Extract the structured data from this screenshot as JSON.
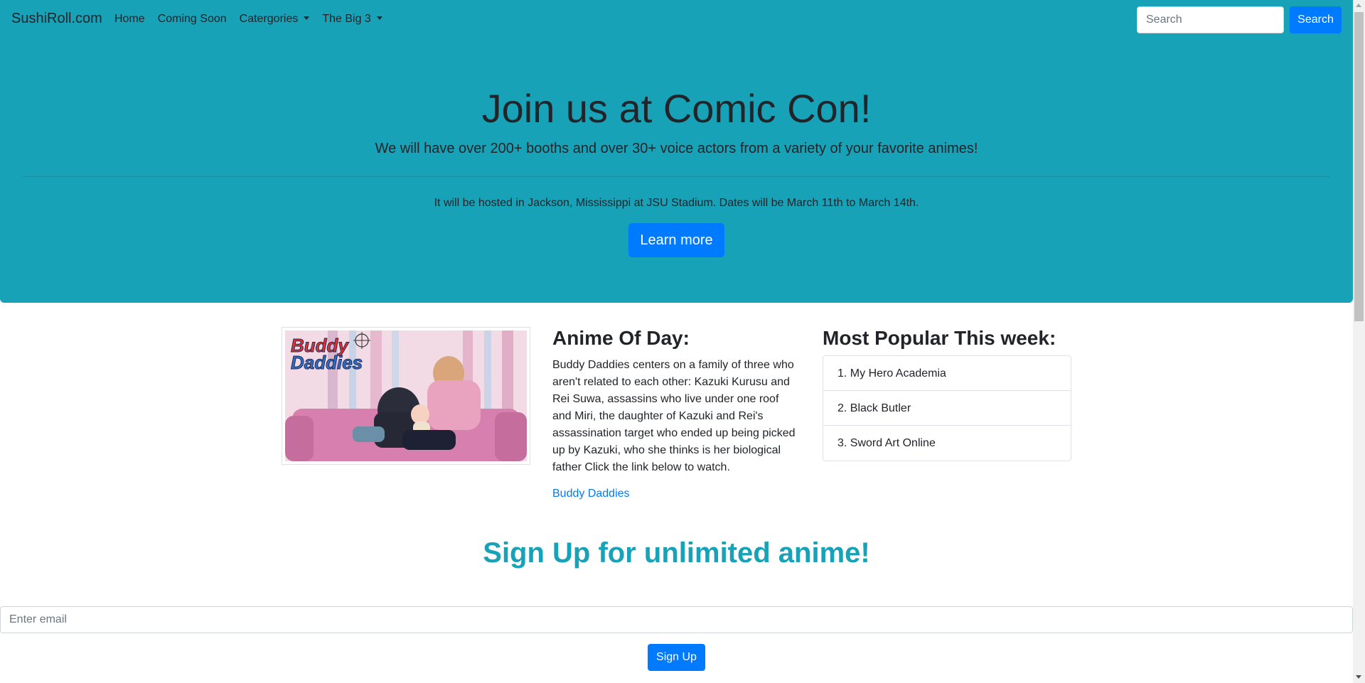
{
  "navbar": {
    "brand": "SushiRoll.com",
    "links": [
      "Home",
      "Coming Soon",
      "Catergories",
      "The Big 3"
    ],
    "search_placeholder": "Search",
    "search_button": "Search"
  },
  "jumbotron": {
    "title": "Join us at Comic Con!",
    "lead": "We will have over 200+ booths and over 30+ voice actors from a variety of your favorite animes!",
    "text": "It will be hosted in Jackson, Mississippi at JSU Stadium. Dates will be March 11th to March 14th.",
    "button": "Learn more"
  },
  "anime_of_day": {
    "image_logo_text": [
      "Buddy",
      "Daddies"
    ],
    "title": "Anime Of Day:",
    "description": "Buddy Daddies centers on a family of three who aren't related to each other: Kazuki Kurusu and Rei Suwa, assassins who live under one roof and Miri, the daughter of Kazuki and Rei's assassination target who ended up being picked up by Kazuki, who she thinks is her biological father Click the link below to watch.",
    "link": "Buddy Daddies"
  },
  "popular": {
    "title": "Most Popular This week:",
    "items": [
      "1. My Hero Academia",
      "2. Black Butler",
      "3. Sword Art Online"
    ]
  },
  "signup": {
    "title": "Sign Up for unlimited anime!",
    "email_placeholder": "Enter email",
    "button": "Sign Up"
  },
  "colors": {
    "primary": "#007bff",
    "info": "#17a2b8",
    "text": "#212529"
  }
}
